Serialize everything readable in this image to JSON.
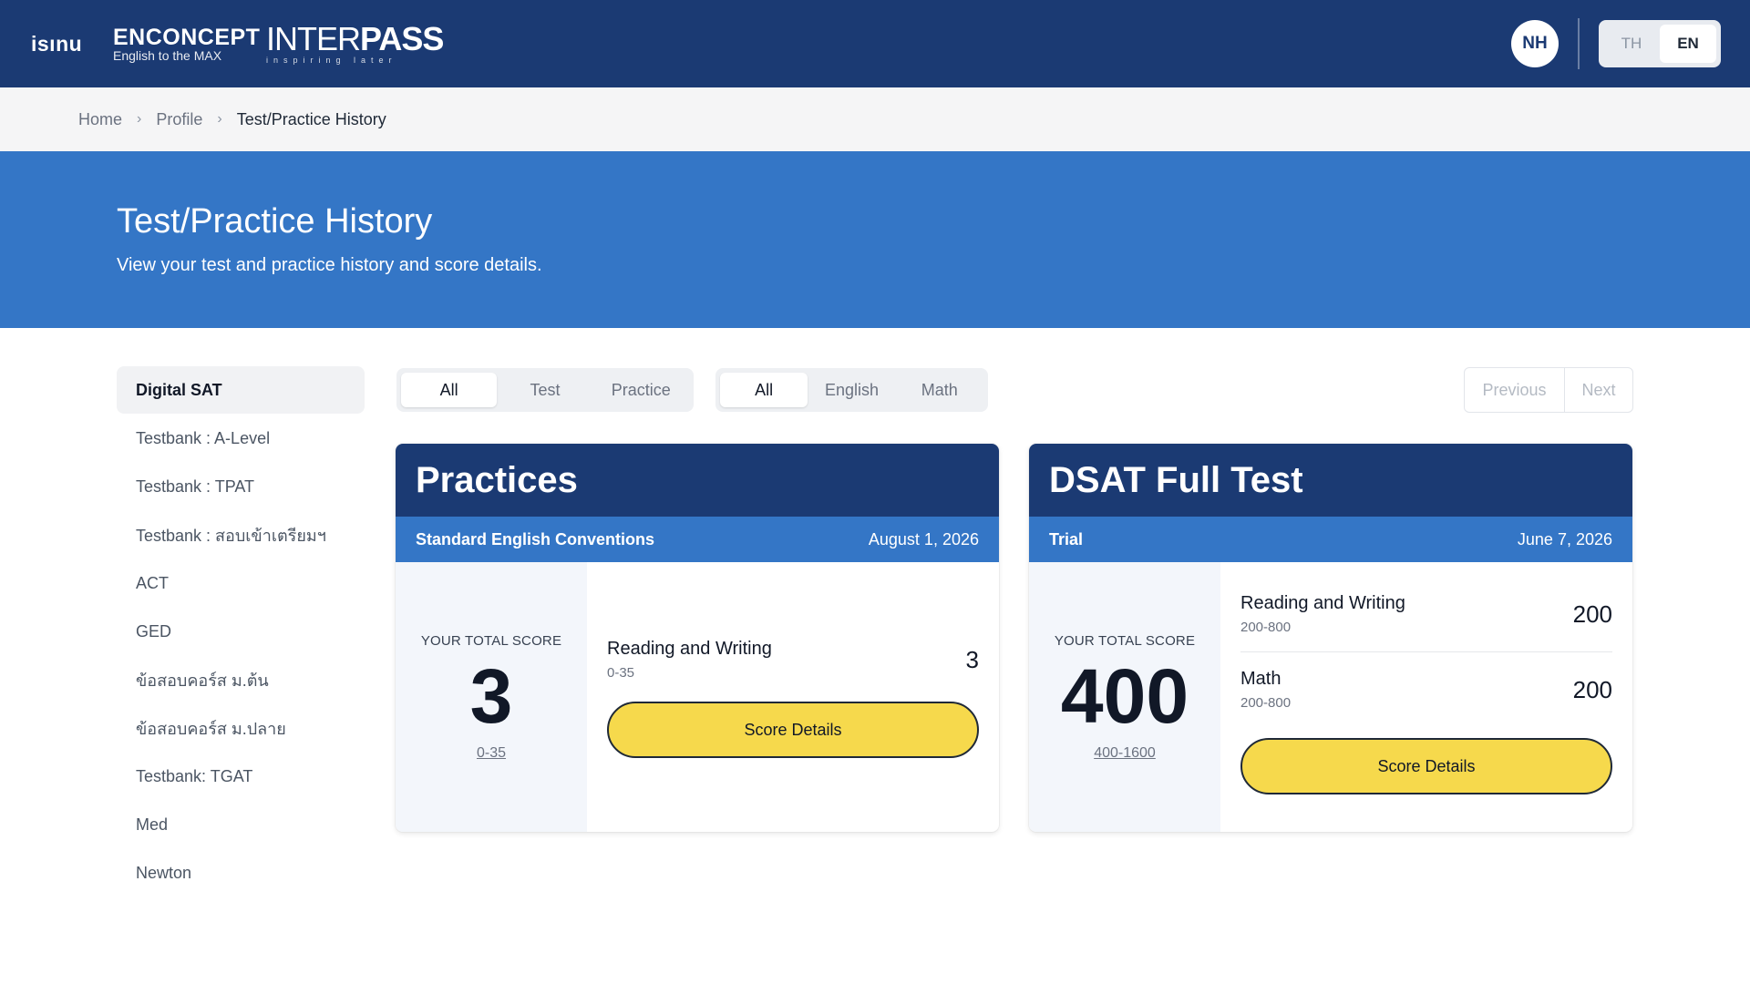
{
  "header": {
    "logos": {
      "isinu": "isınu",
      "enconcept": "ENCONCEPT",
      "enconcept_tagline": "English to the MAX",
      "interpass_light": "INTER",
      "interpass_bold": "PASS",
      "interpass_tagline": "inspiring later"
    },
    "avatar_initials": "NH",
    "languages": [
      "TH",
      "EN"
    ],
    "active_language": "EN"
  },
  "breadcrumb": {
    "items": [
      "Home",
      "Profile"
    ],
    "current": "Test/Practice History"
  },
  "hero": {
    "title": "Test/Practice History",
    "subtitle": "View your test and practice history and score details."
  },
  "sidebar": {
    "items": [
      "Digital SAT",
      "Testbank : A-Level",
      "Testbank : TPAT",
      "Testbank : สอบเข้าเตรียมฯ",
      "ACT",
      "GED",
      "ข้อสอบคอร์ส ม.ต้น",
      "ข้อสอบคอร์ส ม.ปลาย",
      "Testbank: TGAT",
      "Med",
      "Newton"
    ],
    "active": "Digital SAT"
  },
  "filters": {
    "type": [
      "All",
      "Test",
      "Practice"
    ],
    "type_active": "All",
    "subject": [
      "All",
      "English",
      "Math"
    ],
    "subject_active": "All"
  },
  "pagination": {
    "previous": "Previous",
    "next": "Next"
  },
  "cards": [
    {
      "title": "Practices",
      "subtitle": "Standard English Conventions",
      "date": "August 1, 2026",
      "score_caption": "YOUR TOTAL SCORE",
      "total_score": "3",
      "total_range": "0-35",
      "sections": [
        {
          "name": "Reading and Writing",
          "range": "0-35",
          "score": "3"
        }
      ],
      "button": "Score Details"
    },
    {
      "title": "DSAT Full Test",
      "subtitle": "Trial",
      "date": "June 7, 2026",
      "score_caption": "YOUR TOTAL SCORE",
      "total_score": "400",
      "total_range": "400-1600",
      "sections": [
        {
          "name": "Reading and Writing",
          "range": "200-800",
          "score": "200"
        },
        {
          "name": "Math",
          "range": "200-800",
          "score": "200"
        }
      ],
      "button": "Score Details"
    }
  ],
  "colors": {
    "navy": "#1b3a73",
    "blue": "#3476c6",
    "yellow": "#f6d94c"
  }
}
